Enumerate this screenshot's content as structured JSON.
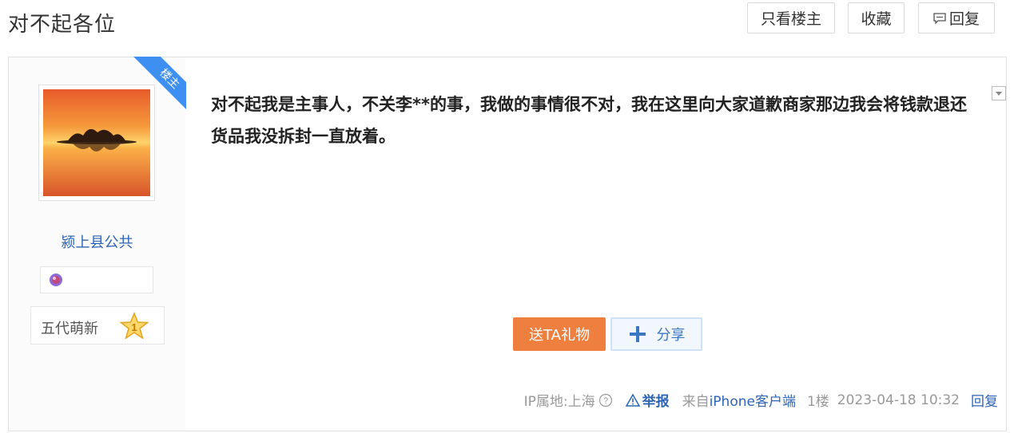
{
  "page": {
    "title": "对不起各位"
  },
  "toolbar": {
    "only_op_label": "只看楼主",
    "favorite_label": "收藏",
    "reply_label": "回复"
  },
  "post": {
    "op_ribbon": "楼主",
    "author": {
      "username": "颍上县公共",
      "level_name": "五代萌新",
      "level_number": "1"
    },
    "content": "对不起我是主事人，不关李**的事，我做的事情很不对，我在这里向大家道歉商家那边我会将钱款退还货品我没拆封一直放着。",
    "gift_label": "送TA礼物",
    "share_label": "分享",
    "meta": {
      "ip_location": "IP属地:上海",
      "report_label": "举报",
      "source": "来自",
      "client": "iPhone客户端",
      "floor": "1楼",
      "datetime": "2023-04-18 10:32",
      "reply_label": "回复"
    }
  },
  "colors": {
    "accent_blue": "#2d64b3",
    "ribbon_blue": "#3d8ff2",
    "gift_orange": "#ef7f3f"
  }
}
